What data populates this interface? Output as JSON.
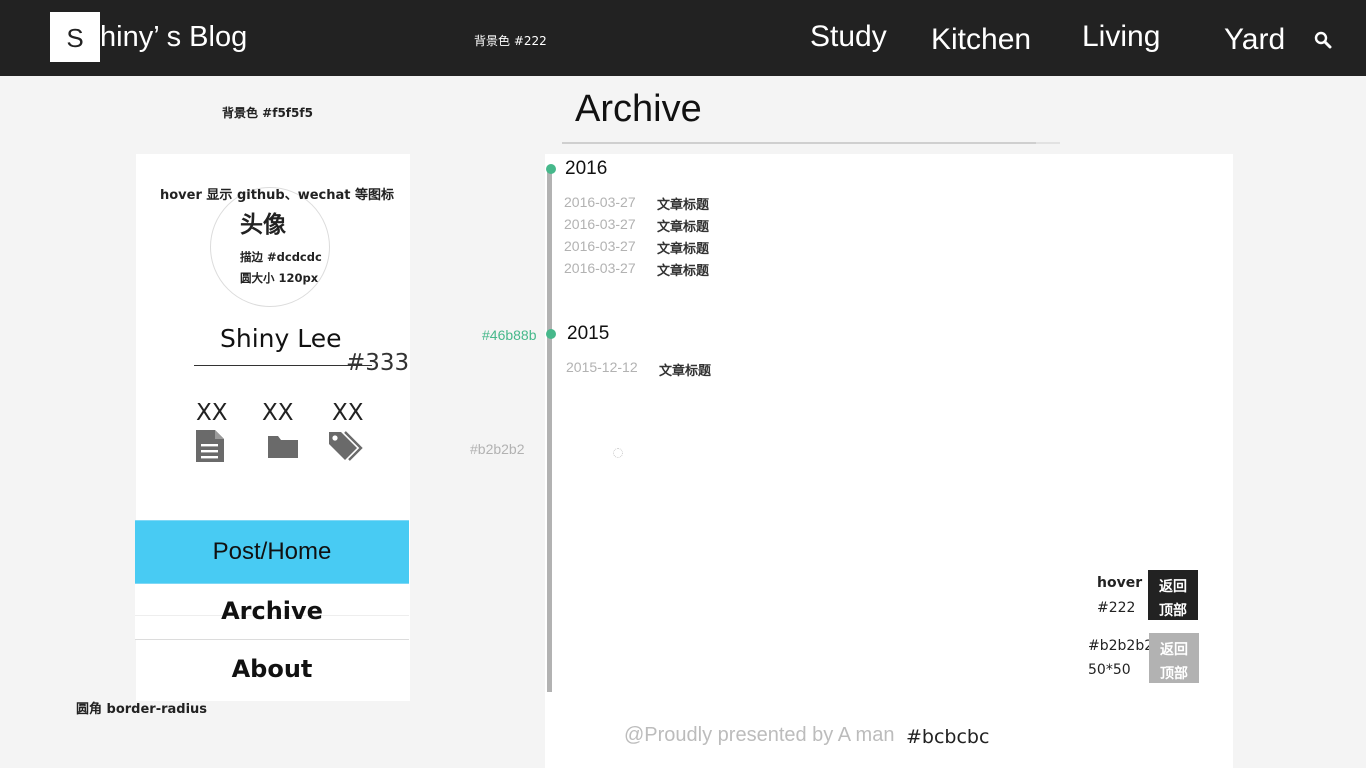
{
  "header": {
    "logo_letter": "S",
    "logo_rest": "hiny’ s  Blog",
    "bg_note": "背景色 #222",
    "nav": [
      "Study",
      "Kitchen",
      "Living",
      "Yard"
    ],
    "search_icon": "search-icon"
  },
  "sidebar": {
    "bg_note": "背景色 #f5f5f5",
    "hover_note": "hover 显示 github、wechat 等图标",
    "avatar_label": "头像",
    "avatar_border_note": "描边 #dcdcdc",
    "avatar_size_note": "圆大小 120px",
    "name": "Shiny Lee",
    "name_color_note": "#333",
    "stats": [
      {
        "count": "XX",
        "icon": "document-icon"
      },
      {
        "count": "XX",
        "icon": "folder-icon"
      },
      {
        "count": "XX",
        "icon": "tags-icon"
      }
    ],
    "menu": [
      "Post/Home",
      "Archive",
      "About"
    ],
    "radius_note": "圆角 border-radius"
  },
  "main": {
    "title": "Archive",
    "years": [
      {
        "year": "2016",
        "posts": [
          {
            "date": "2016-03-27",
            "title": "文章标题"
          },
          {
            "date": "2016-03-27",
            "title": "文章标题"
          },
          {
            "date": "2016-03-27",
            "title": "文章标题"
          },
          {
            "date": "2016-03-27",
            "title": "文章标题"
          }
        ]
      },
      {
        "year": "2015",
        "posts": [
          {
            "date": "2015-12-12",
            "title": "文章标题"
          }
        ]
      }
    ],
    "dot_color_note": "#46b88b",
    "line_color_note": "#b2b2b2",
    "colors": {
      "accent": "#46b88b",
      "line": "#b2b2b2",
      "menu_active": "#48cbf3",
      "header": "#222222"
    }
  },
  "back_to_top": {
    "hover_label": "hover",
    "hover_color": "#222",
    "line1": "返回",
    "line2": "顶部",
    "gray_color": "#b2b2b2",
    "size": "50*50"
  },
  "footer": {
    "text": "@Proudly presented by A man",
    "color_note": "#bcbcbc"
  }
}
